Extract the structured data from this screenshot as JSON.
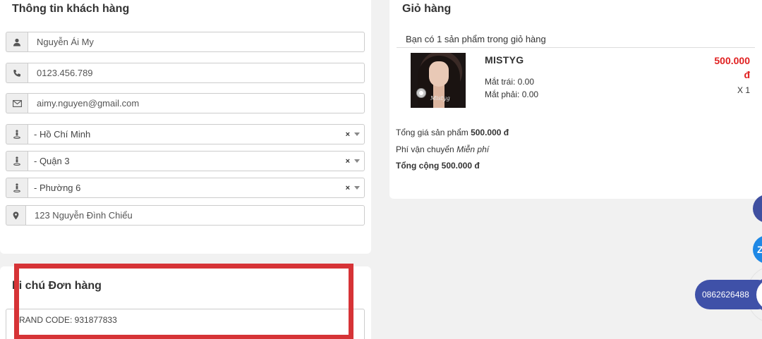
{
  "customer": {
    "title": "Thông tin khách hàng",
    "name": "Nguyễn Ái My",
    "phone": "0123.456.789",
    "email": "aimy.nguyen@gmail.com",
    "province": " - Hồ Chí Minh",
    "district": "- Quận 3",
    "ward": "- Phường 6",
    "address": "123 Nguyễn Đình Chiểu",
    "clear_glyph": "×"
  },
  "cart": {
    "title": "Giỏ hàng",
    "subtitle": "Bạn có 1 sản phẩm trong giỏ hàng",
    "item": {
      "name": "MISTYG",
      "left_eye": "Mắt trái: 0.00",
      "right_eye": "Mắt phải: 0.00",
      "price": "500.000",
      "currency": "đ",
      "qty": "X 1",
      "image_signature": "Mistyg"
    },
    "subtotal_label": "Tổng giá sản phẩm",
    "subtotal_value": "500.000 đ",
    "shipping_label": "Phí vận chuyển",
    "shipping_value": "Miễn phí",
    "total_text": "Tổng cộng 500.000 đ"
  },
  "note": {
    "title_visible": "hi chú Đơn hàng",
    "text_visible": "RAND CODE: 931877833"
  },
  "floating": {
    "zalo_letter": "Z",
    "phone": "0862626488"
  },
  "colors": {
    "price_red": "#e02020",
    "highlight_red": "#d63336",
    "pill_blue": "#3f51a8",
    "zalo_blue": "#1e88e5"
  }
}
